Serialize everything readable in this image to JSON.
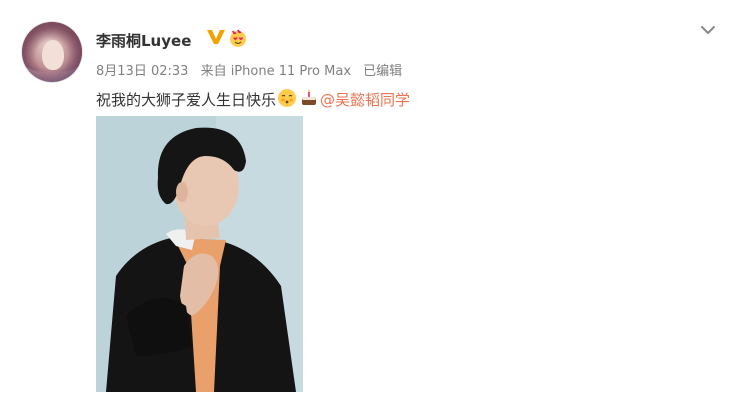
{
  "post": {
    "author_name": "李雨桐Luyee",
    "verified_badge": "v-badge-icon",
    "vip_badge": "vip-emoji-icon",
    "meta": {
      "date": "8月13日 02:33",
      "source": "来自 iPhone 11 Pro Max",
      "edited": "已编辑"
    },
    "text": "祝我的大狮子爱人生日快乐",
    "emojis": [
      "shy-face-emoji",
      "cake-emoji"
    ],
    "mention": "@吴懿韬同学",
    "menu_icon": "chevron-down-icon"
  },
  "colors": {
    "name": "#333333",
    "meta": "#808080",
    "mention_link": "#eb7350",
    "verified": "#f3a200"
  }
}
